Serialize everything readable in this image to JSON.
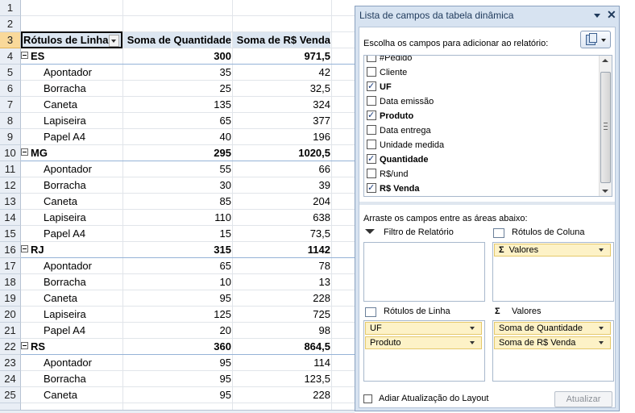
{
  "sheet": {
    "header": {
      "row": "3",
      "a": "Rótulos de Linha",
      "b": "Soma de Quantidade",
      "c": "Soma de R$ Venda"
    },
    "rows": [
      {
        "n": "1",
        "a": "",
        "b": "",
        "c": "",
        "kind": "blank"
      },
      {
        "n": "2",
        "a": "",
        "b": "",
        "c": "",
        "kind": "blank"
      },
      {
        "n": "4",
        "a": "ES",
        "b": "300",
        "c": "971,5",
        "kind": "group"
      },
      {
        "n": "5",
        "a": "Apontador",
        "b": "35",
        "c": "42",
        "kind": "item"
      },
      {
        "n": "6",
        "a": "Borracha",
        "b": "25",
        "c": "32,5",
        "kind": "item"
      },
      {
        "n": "7",
        "a": "Caneta",
        "b": "135",
        "c": "324",
        "kind": "item"
      },
      {
        "n": "8",
        "a": "Lapiseira",
        "b": "65",
        "c": "377",
        "kind": "item"
      },
      {
        "n": "9",
        "a": "Papel A4",
        "b": "40",
        "c": "196",
        "kind": "item"
      },
      {
        "n": "10",
        "a": "MG",
        "b": "295",
        "c": "1020,5",
        "kind": "group"
      },
      {
        "n": "11",
        "a": "Apontador",
        "b": "55",
        "c": "66",
        "kind": "item"
      },
      {
        "n": "12",
        "a": "Borracha",
        "b": "30",
        "c": "39",
        "kind": "item"
      },
      {
        "n": "13",
        "a": "Caneta",
        "b": "85",
        "c": "204",
        "kind": "item"
      },
      {
        "n": "14",
        "a": "Lapiseira",
        "b": "110",
        "c": "638",
        "kind": "item"
      },
      {
        "n": "15",
        "a": "Papel A4",
        "b": "15",
        "c": "73,5",
        "kind": "item"
      },
      {
        "n": "16",
        "a": "RJ",
        "b": "315",
        "c": "1142",
        "kind": "group"
      },
      {
        "n": "17",
        "a": "Apontador",
        "b": "65",
        "c": "78",
        "kind": "item"
      },
      {
        "n": "18",
        "a": "Borracha",
        "b": "10",
        "c": "13",
        "kind": "item"
      },
      {
        "n": "19",
        "a": "Caneta",
        "b": "95",
        "c": "228",
        "kind": "item"
      },
      {
        "n": "20",
        "a": "Lapiseira",
        "b": "125",
        "c": "725",
        "kind": "item"
      },
      {
        "n": "21",
        "a": "Papel A4",
        "b": "20",
        "c": "98",
        "kind": "item"
      },
      {
        "n": "22",
        "a": "RS",
        "b": "360",
        "c": "864,5",
        "kind": "group"
      },
      {
        "n": "23",
        "a": "Apontador",
        "b": "95",
        "c": "114",
        "kind": "item"
      },
      {
        "n": "24",
        "a": "Borracha",
        "b": "95",
        "c": "123,5",
        "kind": "item"
      },
      {
        "n": "25",
        "a": "Caneta",
        "b": "95",
        "c": "228",
        "kind": "item"
      }
    ]
  },
  "panel": {
    "title": "Lista de campos da tabela dinâmica",
    "choose_label": "Escolha os campos para adicionar ao relatório:",
    "fields": [
      {
        "label": "#Pedido",
        "checked": false
      },
      {
        "label": "Cliente",
        "checked": false
      },
      {
        "label": "UF",
        "checked": true
      },
      {
        "label": "Data emissão",
        "checked": false
      },
      {
        "label": "Produto",
        "checked": true
      },
      {
        "label": "Data entrega",
        "checked": false
      },
      {
        "label": "Unidade medida",
        "checked": false
      },
      {
        "label": "Quantidade",
        "checked": true
      },
      {
        "label": "R$/und",
        "checked": false
      },
      {
        "label": "R$ Venda",
        "checked": true
      }
    ],
    "drag_label": "Arraste os campos entre as áreas abaixo:",
    "areas": {
      "filter_title": "Filtro de Relatório",
      "columns_title": "Rótulos de Coluna",
      "rows_title": "Rótulos de Linha",
      "values_title": "Valores",
      "columns_items": [
        "Valores"
      ],
      "rows_items": [
        "UF",
        "Produto"
      ],
      "values_items": [
        "Soma de Quantidade",
        "Soma de R$ Venda"
      ]
    },
    "defer_label": "Adiar Atualização do Layout",
    "update_button": "Atualizar"
  },
  "colors": {
    "selected_header": "#f9d99a",
    "pivot_header": "#dce6f1",
    "panel_bg": "#d7e3f1",
    "chip": "#fdf2c7"
  }
}
